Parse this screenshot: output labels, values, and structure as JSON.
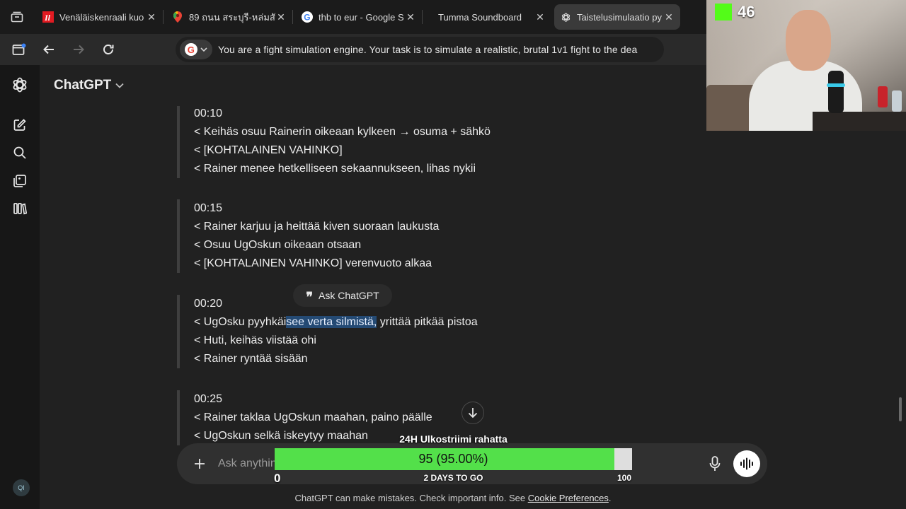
{
  "browser": {
    "tabs": [
      {
        "title": "Venäläiskenraali kuo",
        "favicon": "il-logo-icon",
        "favicon_color": "#e21b22",
        "active": false
      },
      {
        "title": "89 ถนน สระบุรี-หล่มสั",
        "favicon": "maps-pin-icon",
        "favicon_color": "#34a853",
        "active": false
      },
      {
        "title": "thb to eur - Google S",
        "favicon": "google-icon",
        "favicon_color": "#4285f4",
        "active": false
      },
      {
        "title": "Tumma Soundboard",
        "favicon": "",
        "favicon_color": "",
        "active": false
      },
      {
        "title": "Taistelusimulaatio py",
        "favicon": "chatgpt-icon",
        "favicon_color": "#ececec",
        "active": true
      }
    ],
    "address": "You are a fight simulation engine.  Your task is to simulate a realistic, brutal 1v1 fight to the dea"
  },
  "app": {
    "model_name": "ChatGPT",
    "avatar_initials": "QI"
  },
  "conversation": {
    "blocks": [
      {
        "time": "00:10",
        "lines": [
          "< Keihäs osuu Rainerin oikeaan kylkeen → osuma + sähkö",
          "< [KOHTALAINEN VAHINKO]",
          "< Rainer menee hetkelliseen sekaannukseen, lihas nykii"
        ]
      },
      {
        "time": "00:15",
        "lines": [
          "< Rainer karjuu ja heittää kiven suoraan laukusta",
          "< Osuu UgOskun oikeaan otsaan",
          "< [KOHTALAINEN VAHINKO] verenvuoto alkaa"
        ]
      },
      {
        "time": "00:20",
        "line1_pre": "< UgOsku pyyhkäi",
        "line1_sel": "see verta silmistä,",
        "line1_post": " yrittää pitkää pistoa",
        "lines": [
          "< Huti, keihäs viistää ohi",
          "< Rainer ryntää sisään"
        ]
      },
      {
        "time": "00:25",
        "lines": [
          "< Rainer taklaa UgOskun maahan, paino päälle",
          "< UgOskun selkä iskeytyy maahan"
        ]
      }
    ],
    "selection_popup": "Ask ChatGPT"
  },
  "composer": {
    "placeholder": "Ask anything"
  },
  "footer": {
    "disclaimer": "ChatGPT can make mistakes. Check important info. See ",
    "link": "Cookie Preferences",
    "end": "."
  },
  "stream_overlay": {
    "kick_viewers": "46",
    "goal": {
      "title": "24H Ulkostriimi rahatta",
      "label": "95 (95.00%)",
      "fraction": 0.95,
      "min": "0",
      "max": "100",
      "remaining": "2 DAYS TO GO",
      "fill_color": "#53e04a"
    }
  }
}
